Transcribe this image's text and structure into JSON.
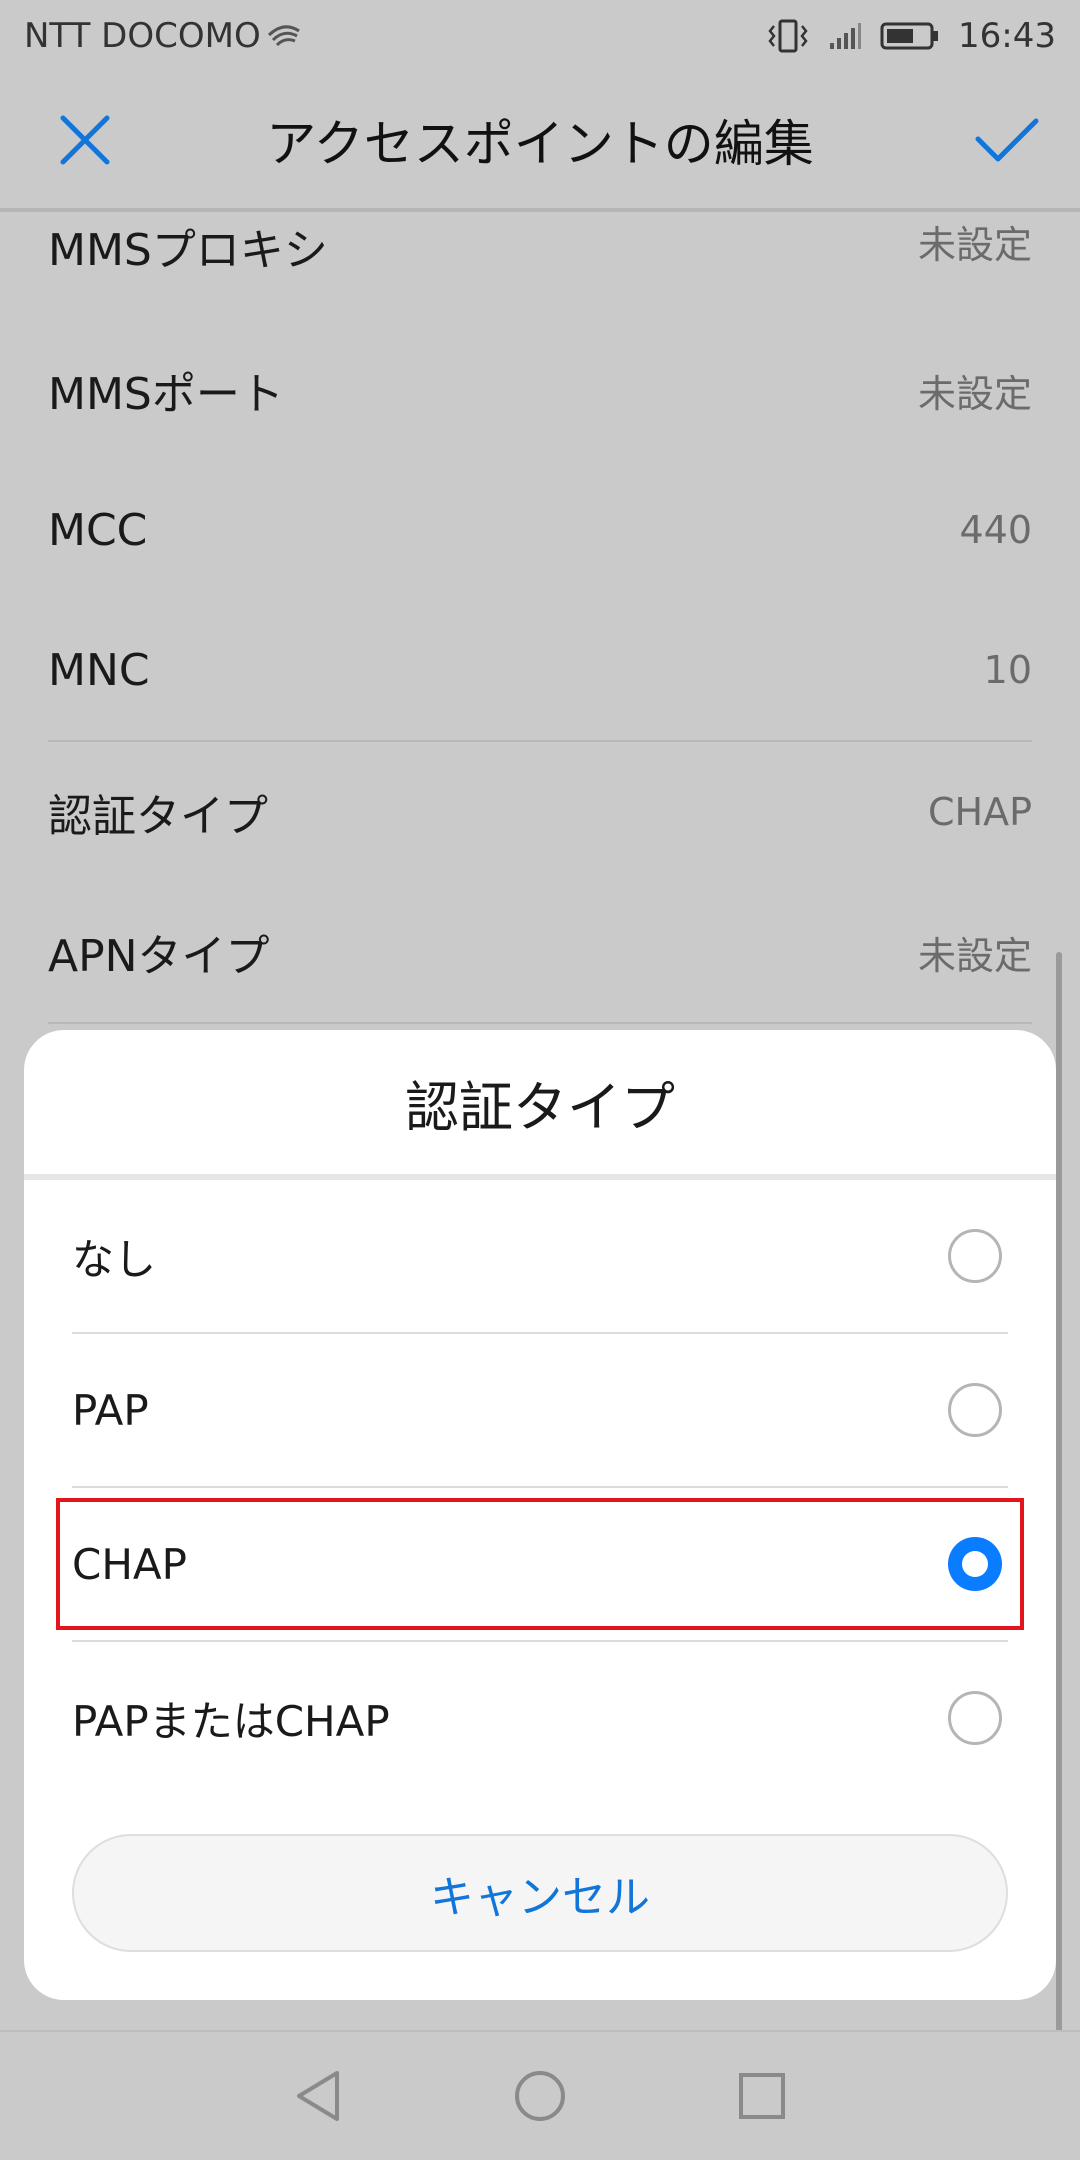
{
  "status_bar": {
    "carrier": "NTT DOCOMO",
    "time": "16:43",
    "icons": [
      "wifi-icon",
      "vibrate-icon",
      "signal-icon",
      "battery-icon"
    ]
  },
  "toolbar": {
    "title": "アクセスポイントの編集",
    "close_icon": "close-icon",
    "confirm_icon": "check-icon",
    "accent_color": "#1275d9"
  },
  "settings": {
    "rows": [
      {
        "label": "MMSプロキシ",
        "value": "未設定"
      },
      {
        "label": "MMSポート",
        "value": "未設定"
      },
      {
        "label": "MCC",
        "value": "440"
      },
      {
        "label": "MNC",
        "value": "10"
      },
      {
        "label": "認証タイプ",
        "value": "CHAP"
      },
      {
        "label": "APNタイプ",
        "value": "未設定"
      }
    ]
  },
  "dialog": {
    "title": "認証タイプ",
    "options": [
      {
        "label": "なし",
        "selected": false
      },
      {
        "label": "PAP",
        "selected": false
      },
      {
        "label": "CHAP",
        "selected": true
      },
      {
        "label": "PAPまたはCHAP",
        "selected": false
      }
    ],
    "cancel_label": "キャンセル",
    "radio_checked_color": "#0a7cff",
    "highlight_color": "#e2141c"
  },
  "nav_bar": {
    "icons": [
      "back-icon",
      "home-icon",
      "recents-icon"
    ]
  }
}
